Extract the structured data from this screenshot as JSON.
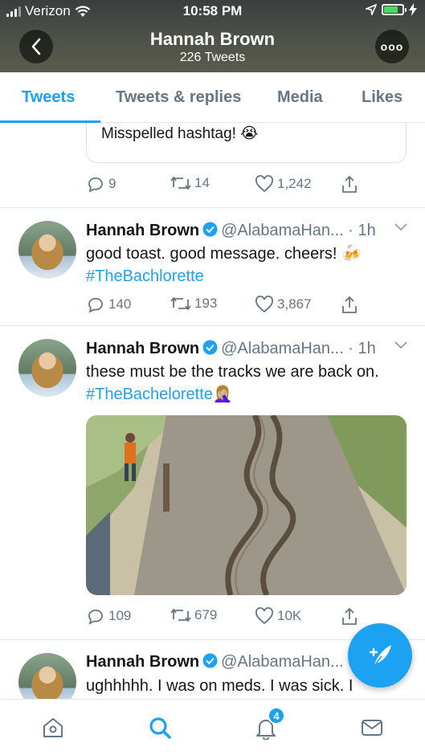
{
  "status_bar": {
    "carrier": "Verizon",
    "time": "10:58 PM",
    "battery_level": 0.75
  },
  "header": {
    "name": "Hannah Brown",
    "tweet_count": "226 Tweets"
  },
  "tabs": [
    {
      "label": "Tweets",
      "active": true
    },
    {
      "label": "Tweets & replies",
      "active": false
    },
    {
      "label": "Media",
      "active": false
    },
    {
      "label": "Likes",
      "active": false
    }
  ],
  "quoted": {
    "text": "Misspelled hashtag! 😭"
  },
  "tweets": [
    {
      "replies": "9",
      "retweets": "14",
      "likes": "1,242"
    },
    {
      "name": "Hannah Brown",
      "handle": "@AlabamaHan...",
      "time": "· 1h",
      "text": "good toast. good message. cheers! 🍻",
      "hashtag": "#TheBachlorette",
      "replies": "140",
      "retweets": "193",
      "likes": "3,867"
    },
    {
      "name": "Hannah Brown",
      "handle": "@AlabamaHan...",
      "time": "· 1h",
      "text": "these must be the tracks we are back on.",
      "hashtag": "#TheBachelorette",
      "hashtag_suffix": "🤦🏼‍♀️",
      "replies": "109",
      "retweets": "679",
      "likes": "10K"
    },
    {
      "name": "Hannah Brown",
      "handle": "@AlabamaHan...",
      "text": "ughhhhh. I was on meds. I was sick. I"
    }
  ],
  "bottom_nav": {
    "notification_count": "4"
  },
  "colors": {
    "accent": "#1da1f2",
    "muted": "#657786"
  }
}
